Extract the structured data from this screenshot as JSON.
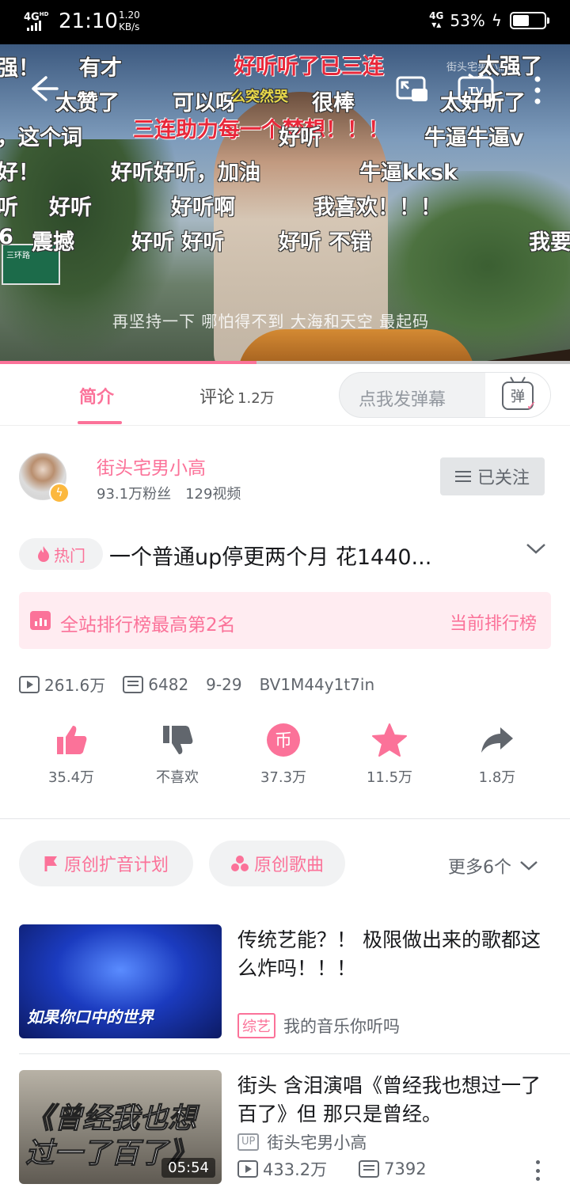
{
  "status_bar": {
    "network": "4G",
    "network_hd": "HD",
    "time": "21:10",
    "speed_value": "1.20",
    "speed_unit": "KB/s",
    "right_network": "4G",
    "battery": "53%",
    "battery_level": 0.53
  },
  "video": {
    "danmaku": [
      "强！",
      "有才",
      "好听听了已三连",
      "太强了",
      "太赞了",
      "可以呀",
      "么突然哭",
      "很棒",
      "太好听了",
      "，这个词",
      "三连助力每一个梦想！！！",
      "好听",
      "牛逼牛逼v",
      "好！",
      "好听好听，加油",
      "牛逼kksk",
      "听",
      "好听",
      "好听啊",
      "我喜欢！！！",
      "6",
      "震撼",
      "好听 好听",
      "好听 不错",
      "我要"
    ],
    "watermark": "街头宅男小高",
    "subtitle": "再坚持一下 哪怕得不到 大海和天空 最起码",
    "sign_text": "三环路",
    "progress": 0.45
  },
  "tabs": {
    "intro": "简介",
    "comments": "评论",
    "comments_count": "1.2万",
    "danmu_placeholder": "点我发弹幕",
    "danmu_icon_char": "弹"
  },
  "uploader": {
    "name": "街头宅男小高",
    "fans": "93.1万粉丝",
    "videos": "129视频",
    "follow_label": "已关注"
  },
  "title": {
    "hot_label": "热门",
    "text": "一个普通up停更两个月 花1440..."
  },
  "rank": {
    "text": "全站排行榜最高第2名",
    "link": "当前排行榜"
  },
  "meta": {
    "views": "261.6万",
    "danmaku_count": "6482",
    "date": "9-29",
    "bvid": "BV1M44y1t7in"
  },
  "actions": {
    "like": "35.4万",
    "dislike": "不喜欢",
    "coin": "37.3万",
    "favorite": "11.5万",
    "share": "1.8万",
    "coin_glyph": "币"
  },
  "tags": {
    "tag1": "原创扩音计划",
    "tag2": "原创歌曲",
    "more": "更多6个"
  },
  "related": [
    {
      "title": "传统艺能？！ 极限做出来的歌都这么炸吗！！！",
      "category": "综艺",
      "source": "我的音乐你听吗",
      "thumb_text": "如果你口中的世界"
    },
    {
      "title": "街头 含泪演唱《曾经我也想过一了百了》但 那只是曾经。",
      "up_tag": "UP",
      "author": "街头宅男小高",
      "views": "433.2万",
      "danmaku": "7392",
      "duration": "05:54",
      "thumb_text": "《曾经我也想过一了百了》"
    }
  ],
  "colors": {
    "accent": "#fb7299",
    "text": "#18191c",
    "secondary": "#61666d"
  }
}
